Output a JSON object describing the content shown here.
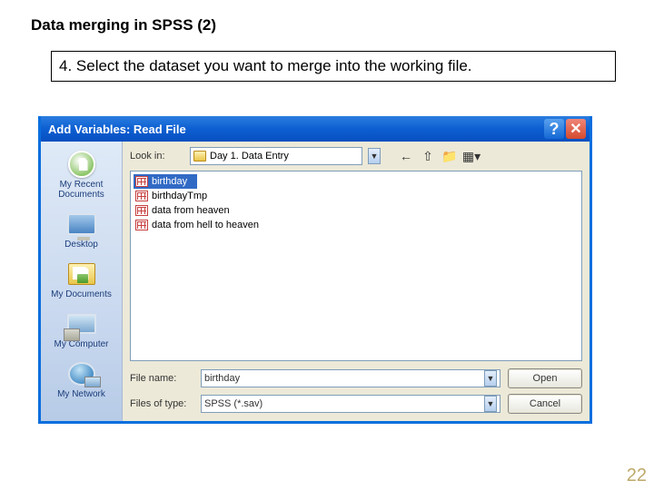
{
  "page": {
    "title": "Data merging in SPSS (2)",
    "instruction": "4.  Select the dataset you want to merge into the working file.",
    "slide_number": "22"
  },
  "dialog": {
    "title": "Add Variables: Read File",
    "lookin_label": "Look in:",
    "lookin_value": "Day 1. Data Entry",
    "sidebar": [
      {
        "label": "My Recent Documents"
      },
      {
        "label": "Desktop"
      },
      {
        "label": "My Documents"
      },
      {
        "label": "My Computer"
      },
      {
        "label": "My Network"
      }
    ],
    "files": [
      {
        "name": "birthday",
        "selected": true
      },
      {
        "name": "birthdayTmp",
        "selected": false
      },
      {
        "name": "data from heaven",
        "selected": false
      },
      {
        "name": "data from hell to heaven",
        "selected": false
      }
    ],
    "filename_label": "File name:",
    "filename_value": "birthday",
    "filetype_label": "Files of type:",
    "filetype_value": "SPSS (*.sav)",
    "open_label": "Open",
    "cancel_label": "Cancel"
  }
}
